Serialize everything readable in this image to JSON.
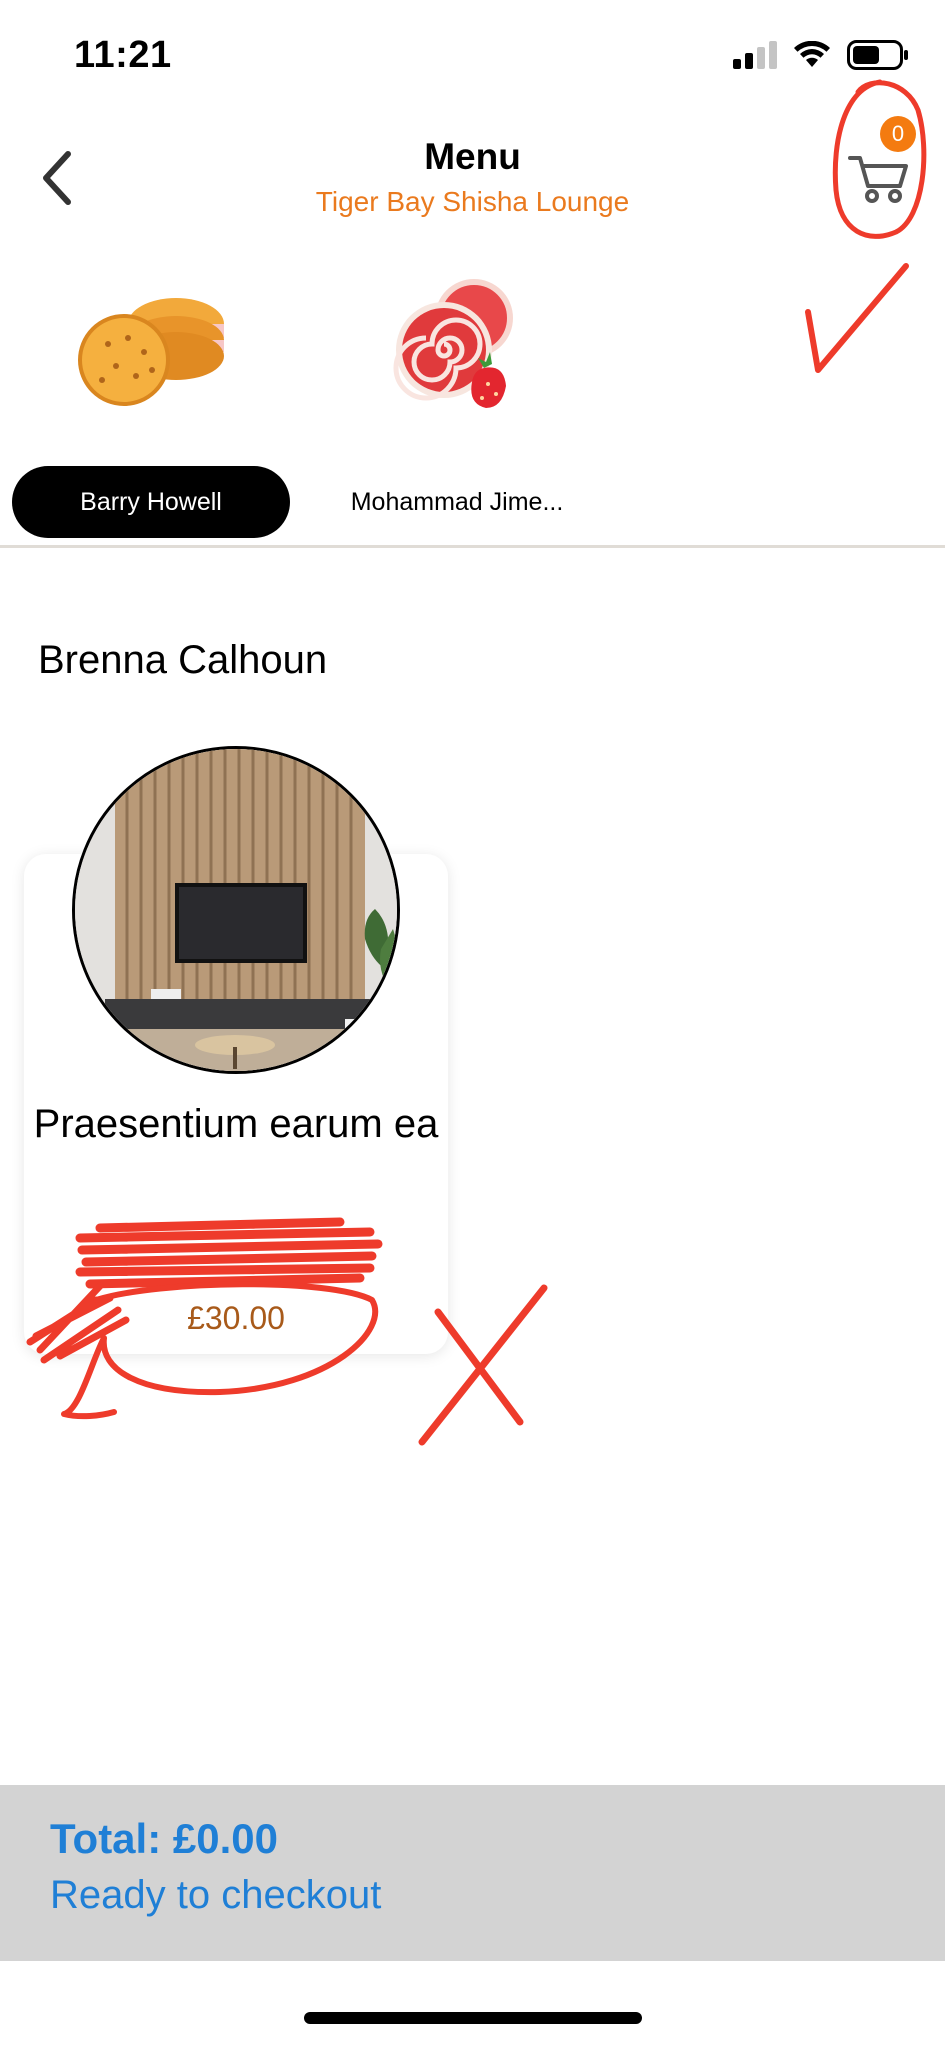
{
  "status_bar": {
    "time": "11:21",
    "icons": [
      "cellular-signal-icon",
      "wifi-icon",
      "battery-icon"
    ]
  },
  "header": {
    "title": "Menu",
    "subtitle": "Tiger Bay Shisha Lounge",
    "back_icon": "chevron-left-icon",
    "cart_icon": "shopping-cart-icon",
    "cart_count": "0"
  },
  "categories": [
    {
      "image": "sandwich-cookies-image"
    },
    {
      "image": "strawberry-swiss-rolls-image"
    }
  ],
  "tabs": [
    {
      "label": "Barry Howell",
      "active": true
    },
    {
      "label": "Mohammad Jime...",
      "active": false
    }
  ],
  "section": {
    "title": "Brenna Calhoun"
  },
  "products": [
    {
      "name": "Praesentium earum ea",
      "price": "£30.00",
      "image": "living-room-tv-wall-photo"
    }
  ],
  "footer": {
    "total": "Total: £0.00",
    "status": "Ready to checkout"
  },
  "colors": {
    "accent_orange": "#ea7a1e",
    "badge_orange": "#f47b10",
    "footer_blue": "#1f7fd6",
    "footer_bg": "#d3d3d3",
    "annotation_red": "#ee3b2b"
  }
}
